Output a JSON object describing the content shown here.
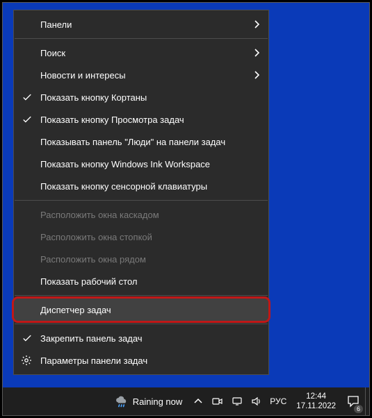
{
  "menu": {
    "items": [
      {
        "label": "Панели",
        "submenu": true
      },
      {
        "sep": true
      },
      {
        "label": "Поиск",
        "submenu": true
      },
      {
        "label": "Новости и интересы",
        "submenu": true
      },
      {
        "label": "Показать кнопку Кортаны",
        "checked": true
      },
      {
        "label": "Показать кнопку Просмотра задач",
        "checked": true
      },
      {
        "label": "Показывать панель \"Люди\" на панели задач"
      },
      {
        "label": "Показать кнопку Windows Ink Workspace"
      },
      {
        "label": "Показать кнопку сенсорной клавиатуры"
      },
      {
        "sep": true
      },
      {
        "label": "Расположить окна каскадом",
        "disabled": true
      },
      {
        "label": "Расположить окна стопкой",
        "disabled": true
      },
      {
        "label": "Расположить окна рядом",
        "disabled": true
      },
      {
        "label": "Показать рабочий стол"
      },
      {
        "sep": true
      },
      {
        "label": "Диспетчер задач",
        "hovered": true,
        "highlight": true
      },
      {
        "sep": true
      },
      {
        "label": "Закрепить панель задач",
        "checked": true
      },
      {
        "label": "Параметры панели задач",
        "gear": true
      }
    ]
  },
  "taskbar": {
    "weather_text": "Raining now",
    "language": "РУС",
    "time": "12:44",
    "date": "17.11.2022",
    "notification_count": "6"
  }
}
